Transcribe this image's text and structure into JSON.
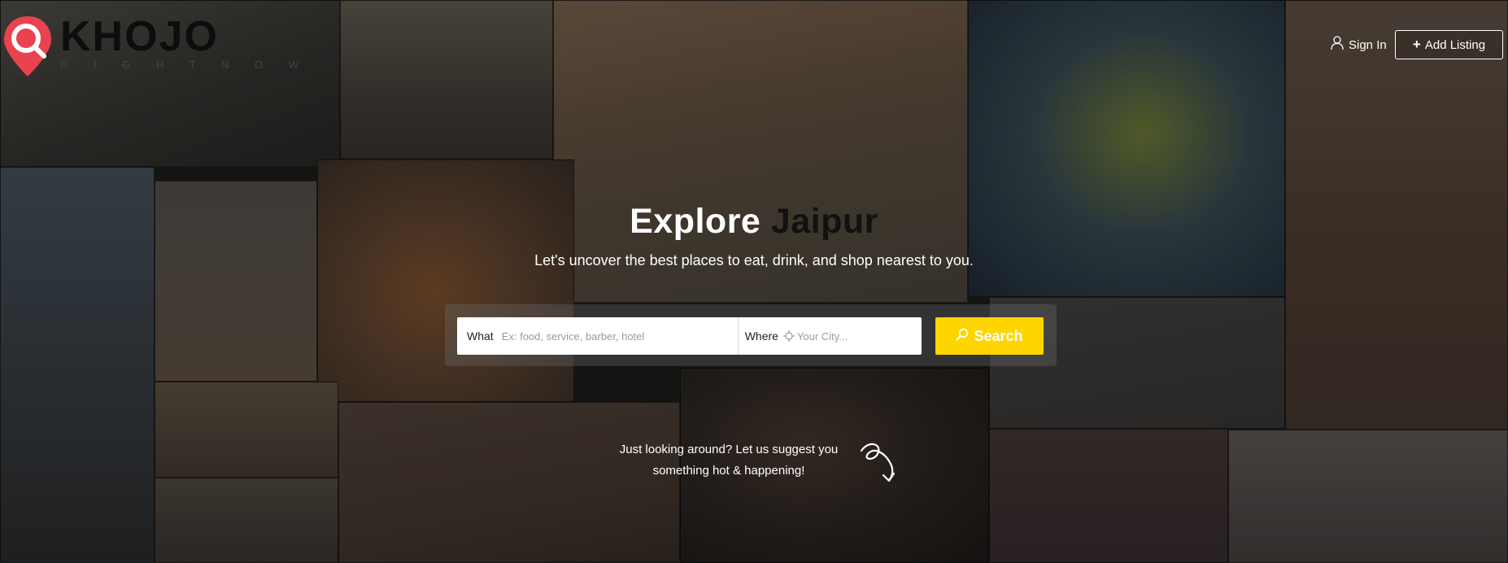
{
  "header": {
    "logo_word": "KHOJO",
    "logo_tagline": "R I G H T N O W",
    "signin_label": "Sign In",
    "add_listing_label": "Add Listing"
  },
  "hero": {
    "title_prefix": "Explore",
    "title_city": "Jaipur",
    "subtitle": "Let's uncover the best places to eat, drink, and shop nearest to you."
  },
  "search": {
    "what_label": "What",
    "what_placeholder": "Ex: food, service, barber, hotel",
    "where_label": "Where",
    "where_placeholder": "Your City...",
    "button_label": "Search"
  },
  "suggestion": {
    "text": "Just looking around? Let us suggest you something hot & happening!"
  },
  "colors": {
    "accent": "#ffd500",
    "brand_red": "#e8434f"
  },
  "icons": [
    "map-pin-search-icon",
    "user-icon",
    "plus-icon",
    "target-icon",
    "search-icon",
    "curly-arrow-icon"
  ]
}
